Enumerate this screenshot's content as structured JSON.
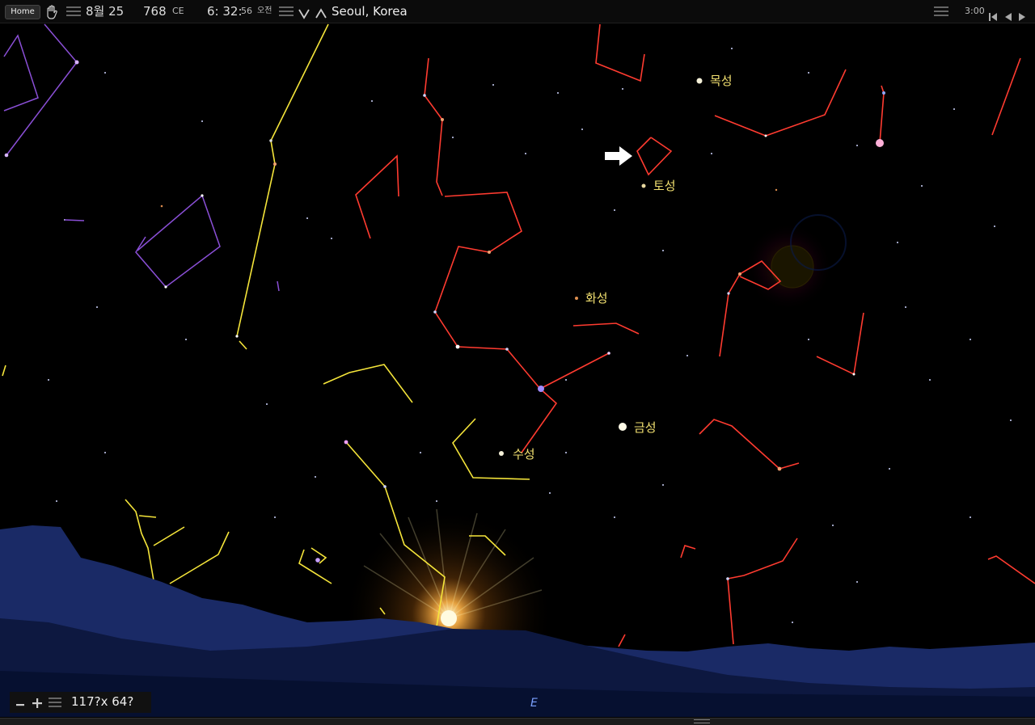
{
  "toolbar": {
    "home_label": "Home",
    "month_day": "8월 25",
    "year": "768",
    "era": "CE",
    "time_hm": "6: 32:",
    "time_s": "56",
    "ampm": "오전",
    "location": "Seoul, Korea",
    "time_rate": "3:00"
  },
  "planets": {
    "jupiter": "목성",
    "saturn": "토성",
    "mars": "화성",
    "venus": "금성",
    "mercury": "수성"
  },
  "compass": {
    "east": "E"
  },
  "status": {
    "resolution": "117?x 64?"
  },
  "colors": {
    "constellation_red": "#ff3b30",
    "constellation_yellow": "#f5e53a",
    "constellation_purple": "#8a4fd6",
    "horizon": "#1a2a66",
    "planet_label": "#f2e070"
  },
  "icons": [
    "hand-icon",
    "menu-icon",
    "chevron-down-icon",
    "chevron-up-icon",
    "skip-back-icon",
    "play-back-icon",
    "play-icon",
    "zoom-out-icon",
    "zoom-in-icon",
    "arrow-right-icon"
  ]
}
